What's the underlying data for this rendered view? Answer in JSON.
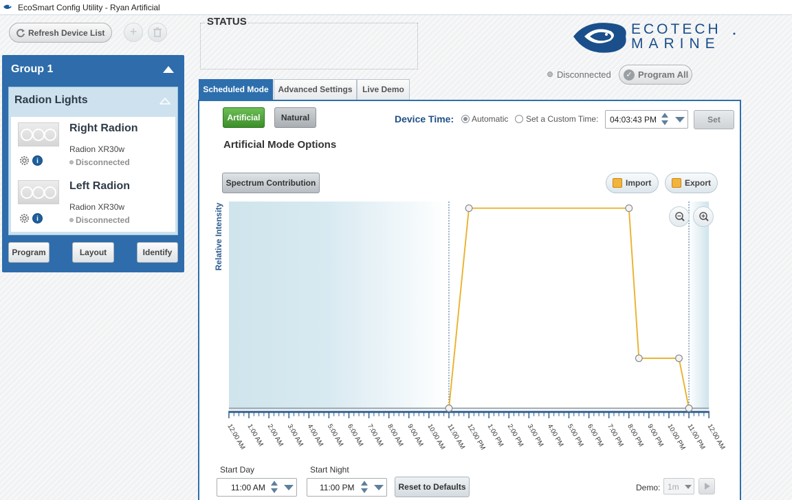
{
  "window": {
    "title": "EcoSmart Config Utility - Ryan Artificial"
  },
  "toolbar": {
    "refresh_label": "Refresh Device List",
    "add_symbol": "+",
    "delete_symbol": "🗑"
  },
  "group": {
    "title": "Group 1",
    "panel_title": "Radion Lights",
    "devices": [
      {
        "name": "Right Radion",
        "model": "Radion XR30w",
        "status": "Disconnected"
      },
      {
        "name": "Left Radion",
        "model": "Radion XR30w",
        "status": "Disconnected"
      }
    ],
    "buttons": {
      "program": "Program",
      "layout": "Layout",
      "identify": "Identify"
    }
  },
  "status": {
    "title": "STATUS"
  },
  "logo": {
    "line1": "ECOTECH",
    "line2": "MARINE",
    "brand_color": "#1a4f8b"
  },
  "connection": {
    "status": "Disconnected",
    "program_all": "Program All"
  },
  "tabs": [
    {
      "label": "Scheduled Mode",
      "active": true
    },
    {
      "label": "Advanced Settings",
      "active": false
    },
    {
      "label": "Live Demo",
      "active": false
    }
  ],
  "mode": {
    "artificial": "Artificial",
    "natural": "Natural",
    "device_time_label": "Device Time:",
    "automatic": "Automatic",
    "custom": "Set a Custom Time:",
    "time_value": "04:03:43 PM",
    "set": "Set",
    "options_title": "Artificial Mode Options",
    "spectrum": "Spectrum Contribution",
    "import": "Import",
    "export": "Export"
  },
  "chart_data": {
    "type": "line",
    "ylabel": "Relative Intensity",
    "x_ticks": [
      "12:00 AM",
      "1:00 AM",
      "2:00 AM",
      "3:00 AM",
      "4:00 AM",
      "5:00 AM",
      "6:00 AM",
      "7:00 AM",
      "8:00 AM",
      "9:00 AM",
      "10:00 AM",
      "11:00 AM",
      "12:00 PM",
      "1:00 PM",
      "2:00 PM",
      "3:00 PM",
      "4:00 PM",
      "5:00 PM",
      "6:00 PM",
      "7:00 PM",
      "8:00 PM",
      "9:00 PM",
      "10:00 PM",
      "11:00 PM",
      "12:00 AM"
    ],
    "xlim_hours": [
      0,
      24
    ],
    "ylim": [
      0,
      100
    ],
    "series": [
      {
        "color": "#e9b32f",
        "points": [
          {
            "x": 11.0,
            "y": 0
          },
          {
            "x": 12.0,
            "y": 100
          },
          {
            "x": 20.0,
            "y": 100
          },
          {
            "x": 20.5,
            "y": 25
          },
          {
            "x": 22.5,
            "y": 25
          },
          {
            "x": 23.0,
            "y": 0
          }
        ]
      }
    ],
    "markers_hours": [
      11.0,
      23.0
    ]
  },
  "bottom": {
    "start_day_label": "Start Day",
    "start_day_value": "11:00 AM",
    "start_night_label": "Start Night",
    "start_night_value": "11:00 PM",
    "reset": "Reset to Defaults",
    "demo_label": "Demo:",
    "demo_value": "1m"
  }
}
